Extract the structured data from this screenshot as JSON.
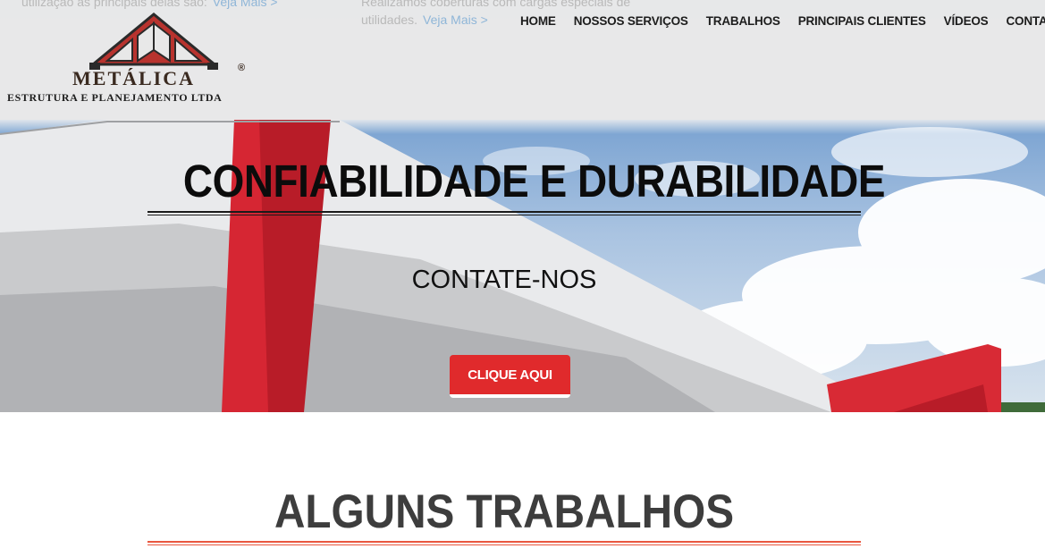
{
  "header": {
    "ghost_left_text": "utilização as principais delas são:",
    "ghost_left_link": "Veja Mais >",
    "ghost_right_line1": "Realizamos coberturas com cargas especiais de",
    "ghost_right_line2": "utilidades.",
    "ghost_right_link": "Veja Mais >",
    "logo": {
      "word": "METÁLICA",
      "registered": "®",
      "subtitle": "ESTRUTURA E PLANEJAMENTO LTDA",
      "brand_color": "#b8332e"
    },
    "nav": [
      {
        "label": "HOME"
      },
      {
        "label": "NOSSOS SERVIÇOS"
      },
      {
        "label": "TRABALHOS"
      },
      {
        "label": "PRINCIPAIS CLIENTES"
      },
      {
        "label": "VÍDEOS"
      },
      {
        "label": "CONTATO"
      }
    ]
  },
  "hero": {
    "title": "CONFIABILIDADE E DURABILIDADE",
    "subtitle": "CONTATE-NOS",
    "cta_label": "CLIQUE AQUI",
    "cta_color": "#e02a2c"
  },
  "section": {
    "title": "ALGUNS TRABALHOS",
    "rule_color": "#e9573f"
  }
}
